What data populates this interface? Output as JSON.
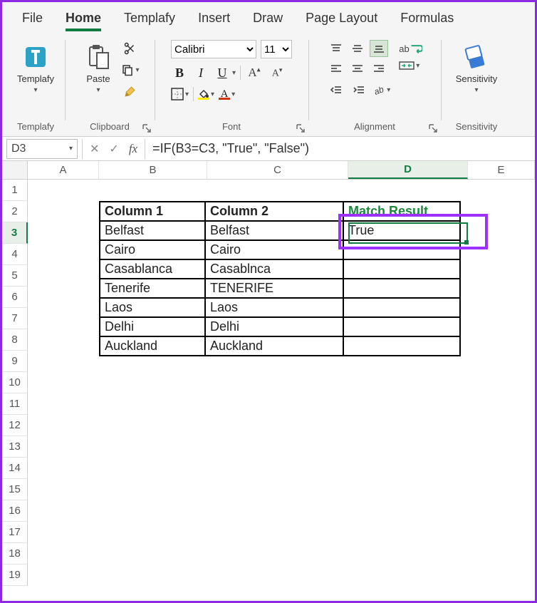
{
  "tabs": {
    "items": [
      "File",
      "Home",
      "Templafy",
      "Insert",
      "Draw",
      "Page Layout",
      "Formulas"
    ],
    "active_index": 1
  },
  "ribbon": {
    "templafy": {
      "label": "Templafy"
    },
    "clipboard": {
      "label": "Clipboard",
      "paste": "Paste"
    },
    "font": {
      "label": "Font",
      "name": "Calibri",
      "size": "11",
      "bold": "B",
      "italic": "I",
      "underline": "U"
    },
    "alignment": {
      "label": "Alignment",
      "wrap": "ab"
    },
    "sensitivity": {
      "label": "Sensitivity",
      "btn": "Sensitivity"
    }
  },
  "formula_bar": {
    "name_box": "D3",
    "fx": "fx",
    "formula": "=IF(B3=C3, \"True\", \"False\")"
  },
  "columns": [
    "A",
    "B",
    "C",
    "D",
    "E"
  ],
  "selected_col": "D",
  "selected_row": 3,
  "row_count": 19,
  "table": {
    "headers": [
      "Column 1",
      "Column 2",
      "Match Result"
    ],
    "rows": [
      {
        "c1": "Belfast",
        "c2": "Belfast",
        "r": "True"
      },
      {
        "c1": "Cairo",
        "c2": "Cairo",
        "r": ""
      },
      {
        "c1": "Casablanca",
        "c2": "Casablnca",
        "r": ""
      },
      {
        "c1": "Tenerife",
        "c2": "TENERIFE",
        "r": ""
      },
      {
        "c1": "Laos",
        "c2": "Laos",
        "r": ""
      },
      {
        "c1": "Delhi",
        "c2": "Delhi",
        "r": ""
      },
      {
        "c1": "Auckland",
        "c2": "Auckland",
        "r": ""
      }
    ]
  },
  "colors": {
    "accent": "#107c41",
    "highlight": "#9b30ff"
  }
}
